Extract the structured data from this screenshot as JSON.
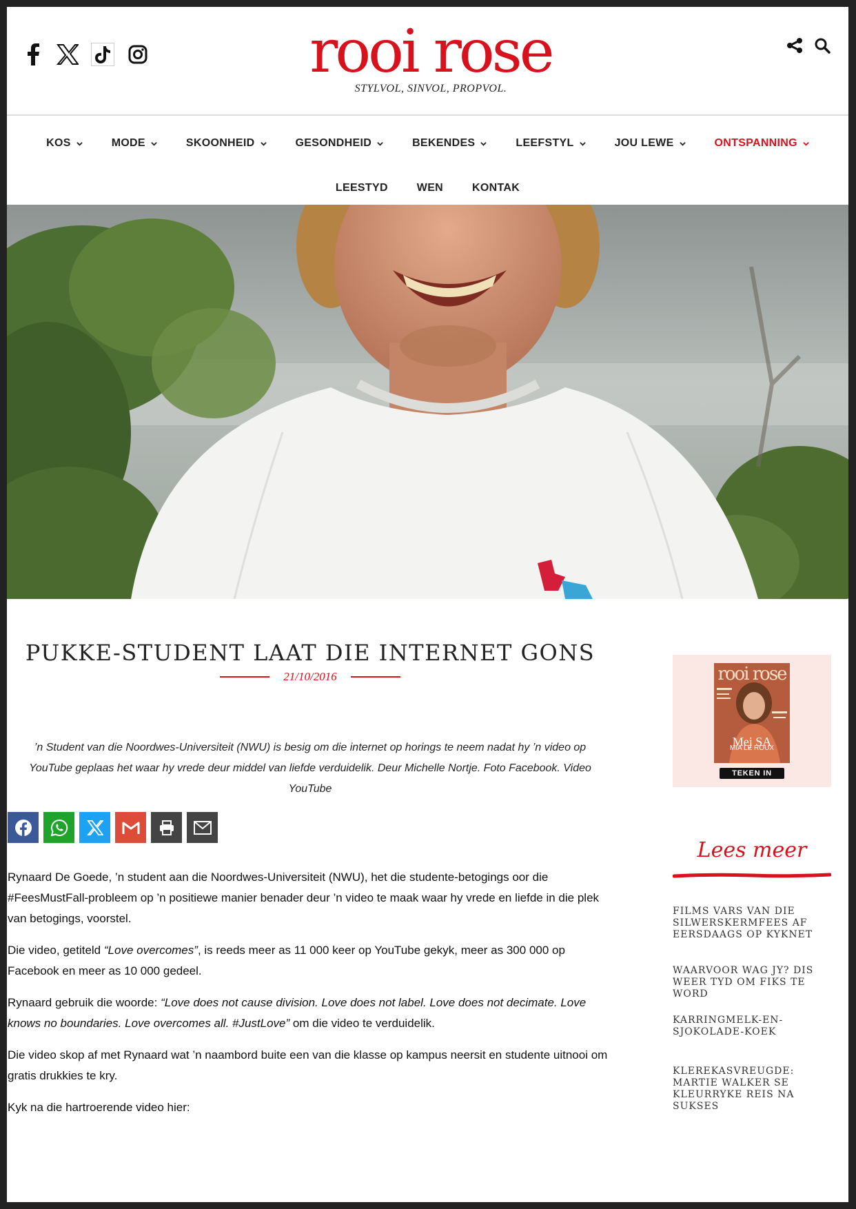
{
  "header": {
    "logo_text": "rooi rose",
    "tagline": "STYLVOL, SINVOL, PROPVOL.",
    "social_icons": [
      "facebook-icon",
      "x-icon",
      "tiktok-icon",
      "instagram-icon"
    ],
    "tool_icons": [
      "share-icon",
      "search-icon"
    ]
  },
  "nav": {
    "row1": [
      {
        "label": "KOS"
      },
      {
        "label": "MODE"
      },
      {
        "label": "SKOONHEID"
      },
      {
        "label": "GESONDHEID"
      },
      {
        "label": "BEKENDES"
      },
      {
        "label": "LEEFSTYL"
      },
      {
        "label": "JOU LEWE"
      },
      {
        "label": "ONTSPANNING"
      }
    ],
    "row2": [
      {
        "label": "LEESTYD"
      },
      {
        "label": "WEN"
      },
      {
        "label": "KONTAK"
      }
    ],
    "active": "ONTSPANNING"
  },
  "article": {
    "title": "PUKKE-STUDENT LAAT DIE INTERNET GONS",
    "date": "21/10/2016",
    "caption": "’n Student van die Noordwes-Universiteit (NWU) is besig om die internet op horings te neem nadat hy ’n video op YouTube geplaas het waar hy vrede deur middel van liefde verduidelik. Deur Michelle Nortje. Foto Facebook. Video YouTube",
    "share_buttons": [
      "facebook-share",
      "whatsapp-share",
      "x-share",
      "gmail-share",
      "print",
      "email-share"
    ],
    "p1": "Rynaard De Goede, ’n student aan die Noordwes-Universiteit (NWU), het die studente-betogings oor die #FeesMustFall-probleem op ’n positiewe manier benader deur ’n video te maak waar hy vrede en liefde in die plek van betogings, voorstel.",
    "p2_a": "Die video, getiteld ",
    "p2_em": "“Love overcomes”",
    "p2_b": ", is reeds meer as 11 000 keer op YouTube gekyk, meer as 300 000 op Facebook en meer as 10 000 gedeel.",
    "p3_a": "Rynaard gebruik die woorde: ",
    "p3_em": "“Love does not cause division. Love does not label. Love does not decimate. Love knows no boundaries. Love overcomes all. #JustLove”",
    "p3_b": " om die video te verduidelik.",
    "p4": "Die video skop af met Rynaard wat ’n naambord buite een van die klasse op kampus neersit en studente uitnooi om gratis drukkies te kry.",
    "p5": "Kyk na die hartroerende video hier:"
  },
  "sidebar": {
    "ad": {
      "cover_title": "rooi rose",
      "cover_name": "Mej SA",
      "cover_sub": "MIA LE ROUX",
      "button": "TEKEN IN"
    },
    "lees_meer": "Lees meer",
    "related": [
      "FILMS VARS VAN DIE SILWERSKERMFEES AF EERSDAAGS OP KYKNET",
      "WAARVOOR WAG JY? DIS WEER TYD OM FIKS TE WORD",
      "KARRINGMELK-EN-SJOKOLADE-KOEK",
      "KLEREKASVREUGDE: MARTIE WALKER SE KLEURRYKE REIS NA SUKSES"
    ]
  },
  "colors": {
    "brand": "#d8121c",
    "facebook": "#3b5998",
    "whatsapp": "#1fa32a",
    "x": "#1da1f2",
    "gmail": "#dd4b39",
    "dark": "#444444"
  }
}
